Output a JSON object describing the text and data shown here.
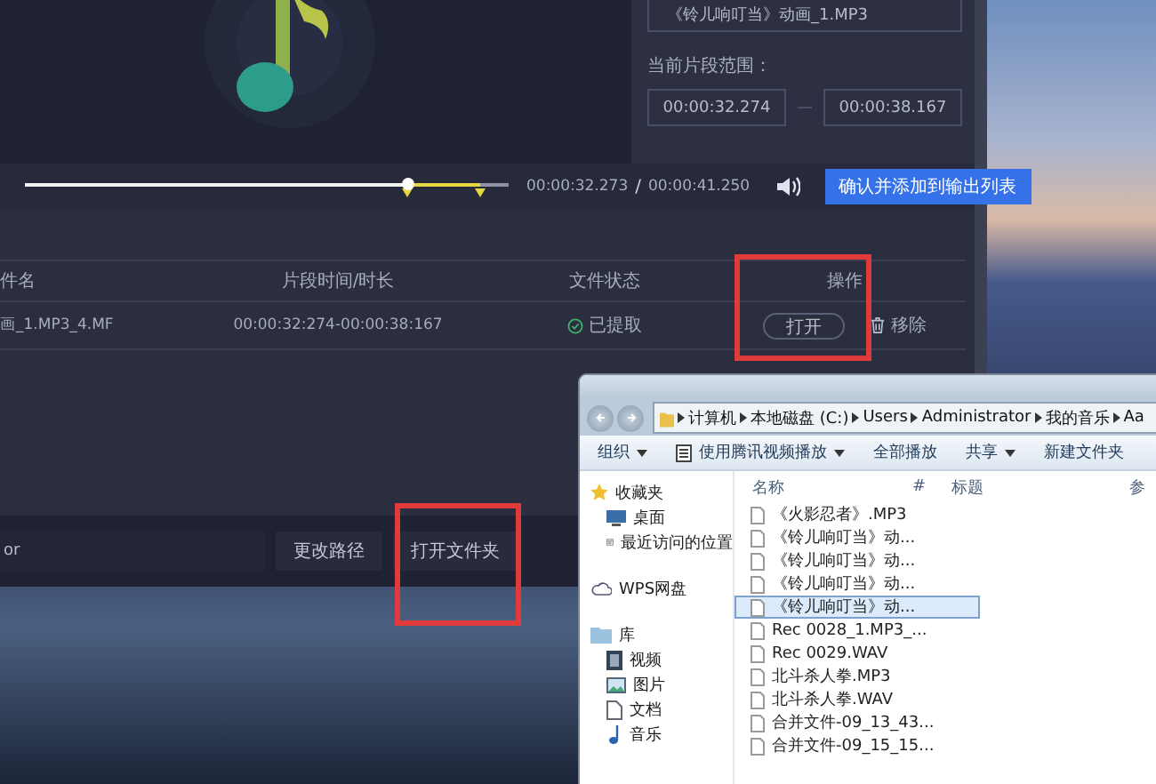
{
  "preview": {
    "file_name": "《铃儿响叮当》动画_1.MP3",
    "range_label": "当前片段范围：",
    "range_start": "00:00:32.274",
    "range_separator": "—",
    "range_end": "00:00:38.167"
  },
  "player": {
    "level": 0.79,
    "current_time": "00:00:32.273",
    "separator": "/",
    "total_time": "00:00:41.250",
    "confirm_button": "确认并添加到输出列表"
  },
  "table": {
    "columns": [
      "件名",
      "片段时间/时长",
      "文件状态",
      "操作"
    ],
    "rows": [
      {
        "file_name": "画_1.MP3_4.MF",
        "segment": "00:00:32:274-00:00:38:167",
        "status": "已提取",
        "open_button": "打开",
        "remove_button": "移除"
      }
    ]
  },
  "output": {
    "path": "or",
    "change_path_button": "更改路径",
    "open_folder_button": "打开文件夹"
  },
  "explorer": {
    "breadcrumb": [
      "计算机",
      "本地磁盘 (C:)",
      "Users",
      "Administrator",
      "我的音乐",
      "Aa"
    ],
    "toolbar": [
      {
        "label": "组织",
        "kind": "menu"
      },
      {
        "label": "使用腾讯视频播放",
        "kind": "player"
      },
      {
        "label": "全部播放",
        "kind": "plain"
      },
      {
        "label": "共享",
        "kind": "menu"
      },
      {
        "label": "新建文件夹",
        "kind": "plain"
      }
    ],
    "nav": [
      {
        "label": "收藏夹",
        "kind": "star",
        "children": [
          {
            "label": "桌面",
            "kind": "desktop"
          },
          {
            "label": "最近访问的位置",
            "kind": "recent"
          }
        ]
      },
      {
        "label": "WPS网盘",
        "kind": "cloud"
      },
      {
        "label": "库",
        "kind": "library",
        "children": [
          {
            "label": "视频",
            "kind": "video"
          },
          {
            "label": "图片",
            "kind": "picture"
          },
          {
            "label": "文档",
            "kind": "document"
          },
          {
            "label": "音乐",
            "kind": "music"
          }
        ]
      }
    ],
    "columns": [
      "名称",
      "#",
      "标题",
      "参"
    ],
    "files": [
      {
        "name": "《火影忍者》.MP3",
        "selected": false
      },
      {
        "name": "《铃儿响叮当》动...",
        "selected": false
      },
      {
        "name": "《铃儿响叮当》动...",
        "selected": false
      },
      {
        "name": "《铃儿响叮当》动...",
        "selected": false
      },
      {
        "name": "《铃儿响叮当》动...",
        "selected": true
      },
      {
        "name": "Rec 0028_1.MP3_...",
        "selected": false
      },
      {
        "name": "Rec 0029.WAV",
        "selected": false
      },
      {
        "name": "北斗杀人拳.MP3",
        "selected": false
      },
      {
        "name": "北斗杀人拳.WAV",
        "selected": false
      },
      {
        "name": "合并文件-09_13_43...",
        "selected": false
      },
      {
        "name": "合并文件-09_15_15...",
        "selected": false
      }
    ]
  }
}
